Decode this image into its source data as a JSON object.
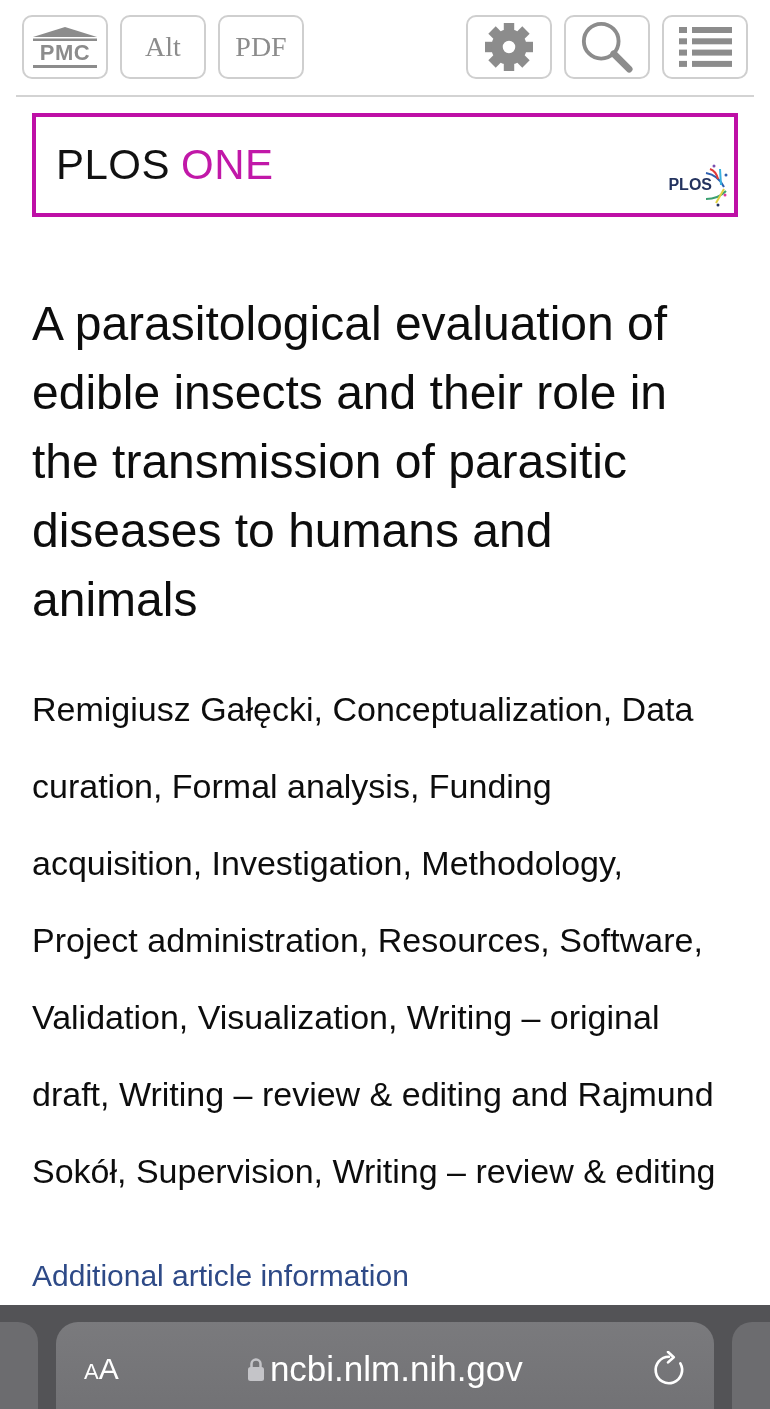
{
  "toolbar": {
    "left_buttons": [
      {
        "kind": "pmc",
        "label": "PMC"
      },
      {
        "kind": "alt",
        "label": "Alt"
      },
      {
        "kind": "pdf",
        "label": "PDF"
      }
    ],
    "right_buttons": [
      {
        "kind": "settings"
      },
      {
        "kind": "search"
      },
      {
        "kind": "contents"
      }
    ]
  },
  "banner": {
    "journal_name": "PLOS",
    "journal_name_accent": "ONE",
    "publisher_logo": "PLOS"
  },
  "article": {
    "title": "A parasitological evaluation of edible insects and their role in the transmission of parasitic diseases to humans and animals",
    "contributors": "Remigiusz Gałęcki, Conceptualization, Data curation, Formal analysis, Funding acquisition, Investigation, Methodology, Project administration, Resources, Software, Validation, Visualization, Writing – original draft, Writing – review & editing and Rajmund Sokół, Supervision, Writing – review & editing",
    "more_info_link": "Additional article information"
  },
  "browser_bar": {
    "text_size_button": "AA",
    "secure": true,
    "url": "ncbi.nlm.nih.gov"
  }
}
